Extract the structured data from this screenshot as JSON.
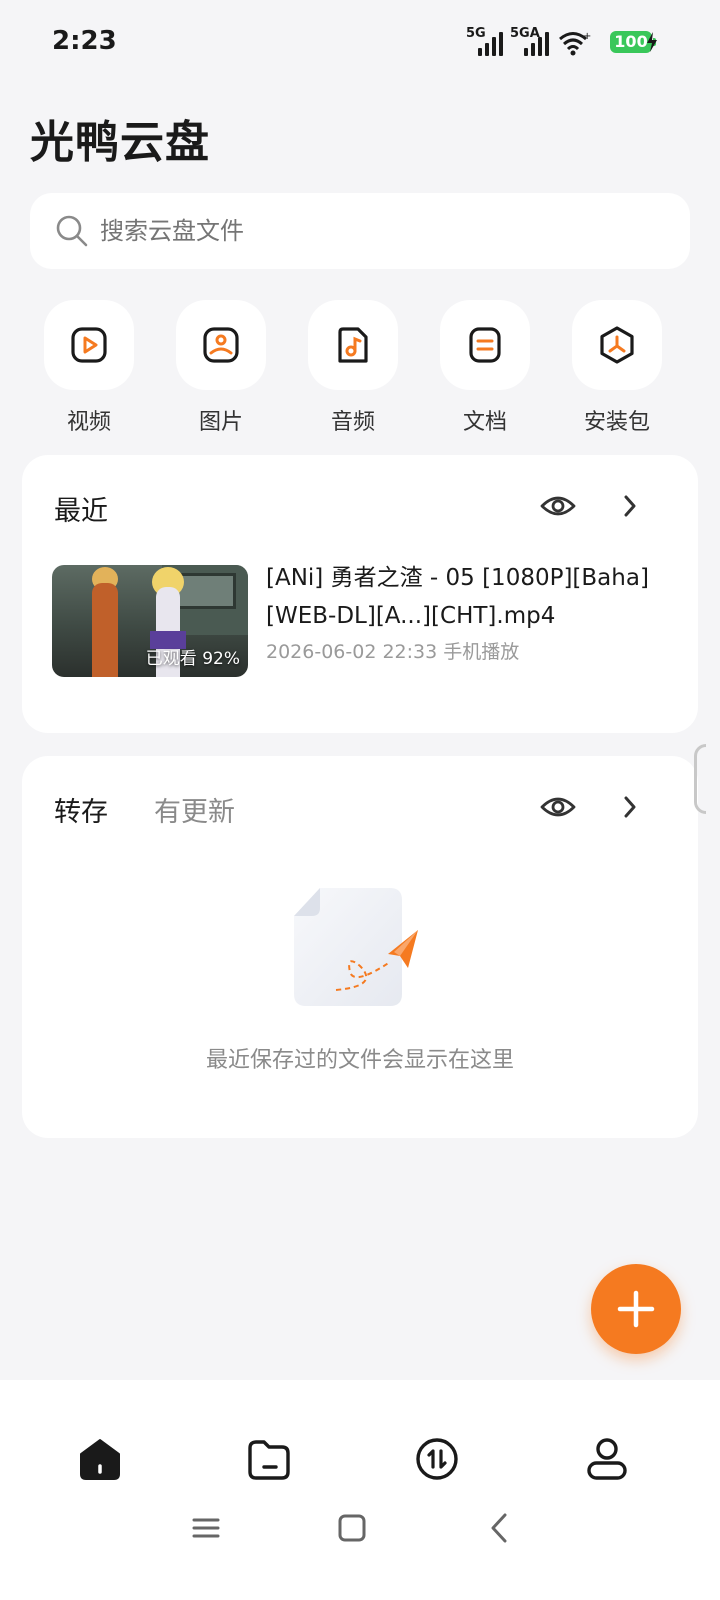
{
  "status_bar": {
    "time": "2:23",
    "signal1_label": "5G",
    "signal2_label": "5GA",
    "battery": "100"
  },
  "app_title": "光鸭云盘",
  "search": {
    "placeholder": "搜索云盘文件"
  },
  "categories": [
    {
      "label": "视频",
      "icon": "video-icon"
    },
    {
      "label": "图片",
      "icon": "image-icon"
    },
    {
      "label": "音频",
      "icon": "audio-icon"
    },
    {
      "label": "文档",
      "icon": "document-icon"
    },
    {
      "label": "安装包",
      "icon": "package-icon"
    }
  ],
  "recent": {
    "title": "最近",
    "item": {
      "name": "[ANi] 勇者之渣 - 05 [1080P][Baha][WEB-DL][A...][CHT].mp4",
      "watched": "已观看 92%",
      "meta": "2026-06-02 22:33 手机播放"
    }
  },
  "transfer": {
    "tab_active": "转存",
    "tab_other": "有更新",
    "empty_text": "最近保存过的文件会显示在这里"
  },
  "colors": {
    "accent": "#f57a20",
    "battery": "#39c75a",
    "background": "#f5f5f7"
  },
  "bottom_nav": [
    "home-icon",
    "folder-icon",
    "transfer-icon",
    "profile-icon"
  ],
  "system_nav": [
    "menu-icon",
    "home-square-icon",
    "back-icon"
  ]
}
